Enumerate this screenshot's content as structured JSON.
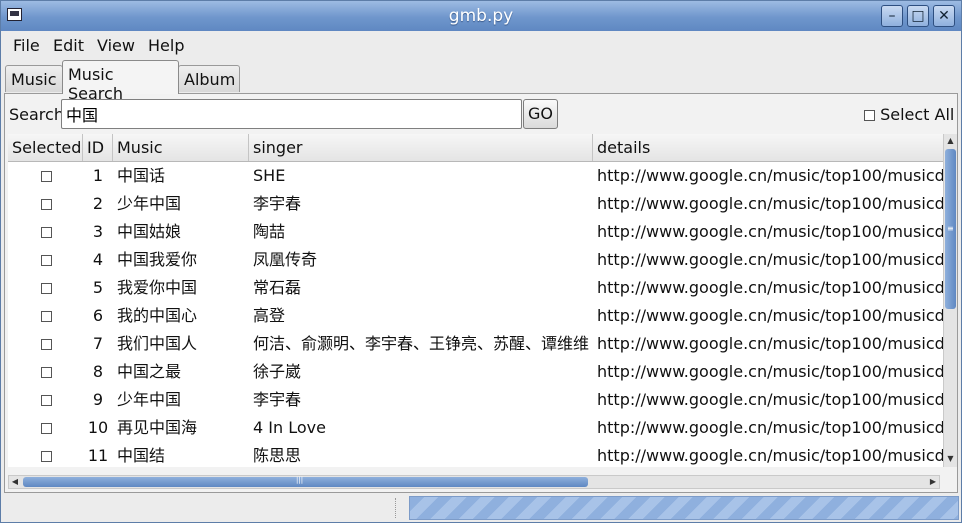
{
  "window": {
    "title": "gmb.py",
    "min": "–",
    "max": "□",
    "close": "✕"
  },
  "menu": [
    {
      "label": "File"
    },
    {
      "label": "Edit"
    },
    {
      "label": "View"
    },
    {
      "label": "Help"
    }
  ],
  "tabs": [
    {
      "label": "Music"
    },
    {
      "label": "Music Search"
    },
    {
      "label": "Album"
    }
  ],
  "active_tab": "Music Search",
  "search": {
    "label": "Search",
    "value": "中国",
    "go_label": "GO",
    "select_all_label": "Select All"
  },
  "table": {
    "columns": [
      "Selected",
      "ID",
      "Music",
      "singer",
      "details"
    ],
    "rows": [
      {
        "id": "1",
        "music": "中国话",
        "singer": "SHE",
        "details": "http://www.google.cn/music/top100/musicd"
      },
      {
        "id": "2",
        "music": "少年中国",
        "singer": "李宇春",
        "details": "http://www.google.cn/music/top100/musicd"
      },
      {
        "id": "3",
        "music": "中国姑娘",
        "singer": "陶喆",
        "details": "http://www.google.cn/music/top100/musicd"
      },
      {
        "id": "4",
        "music": "中国我爱你",
        "singer": "凤凰传奇",
        "details": "http://www.google.cn/music/top100/musicd"
      },
      {
        "id": "5",
        "music": "我爱你中国",
        "singer": "常石磊",
        "details": "http://www.google.cn/music/top100/musicd"
      },
      {
        "id": "6",
        "music": "我的中国心",
        "singer": "高登",
        "details": "http://www.google.cn/music/top100/musicd"
      },
      {
        "id": "7",
        "music": "我们中国人",
        "singer": "何洁、俞灏明、李宇春、王铮亮、苏醒、谭维维",
        "details": "http://www.google.cn/music/top100/musicd"
      },
      {
        "id": "8",
        "music": "中国之最",
        "singer": "徐子崴",
        "details": "http://www.google.cn/music/top100/musicd"
      },
      {
        "id": "9",
        "music": "少年中国",
        "singer": "李宇春",
        "details": "http://www.google.cn/music/top100/musicd"
      },
      {
        "id": "10",
        "music": "再见中国海",
        "singer": "4 In Love",
        "details": "http://www.google.cn/music/top100/musicd"
      },
      {
        "id": "11",
        "music": "中国结",
        "singer": "陈思思",
        "details": "http://www.google.cn/music/top100/musicd"
      }
    ]
  },
  "scroll_grip": "≡",
  "hscroll_grip": "|||"
}
